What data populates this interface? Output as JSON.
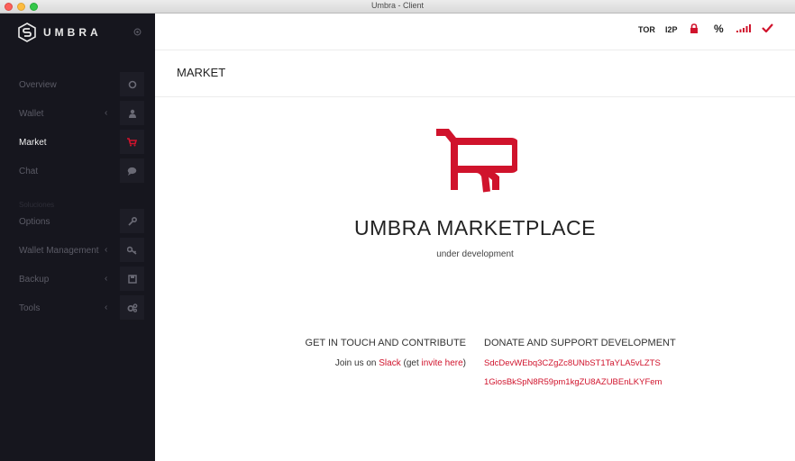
{
  "window": {
    "title": "Umbra - Client"
  },
  "logo": {
    "text": "UMBRA"
  },
  "sidebar": {
    "items": [
      {
        "label": "Overview",
        "icon": "circle-icon",
        "chevron": false,
        "active": false
      },
      {
        "label": "Wallet",
        "icon": "user-icon",
        "chevron": true,
        "active": false
      },
      {
        "label": "Market",
        "icon": "cart-icon",
        "chevron": false,
        "active": true
      },
      {
        "label": "Chat",
        "icon": "chat-icon",
        "chevron": false,
        "active": false
      },
      {
        "label": "Options",
        "icon": "wrench-icon",
        "chevron": false,
        "active": false
      },
      {
        "label": "Wallet Management",
        "icon": "key-icon",
        "chevron": true,
        "active": false
      },
      {
        "label": "Backup",
        "icon": "save-icon",
        "chevron": true,
        "active": false
      },
      {
        "label": "Tools",
        "icon": "cogs-icon",
        "chevron": true,
        "active": false
      }
    ],
    "section_label": "Soluciones"
  },
  "topbar": {
    "tor": "TOR",
    "i2p": "I2P",
    "percent": "%"
  },
  "page": {
    "title": "MARKET"
  },
  "market": {
    "title": "UMBRA MARKETPLACE",
    "subtitle": "under development"
  },
  "contact": {
    "heading": "GET IN TOUCH AND CONTRIBUTE",
    "prefix": "Join us on ",
    "slack": "Slack",
    "mid": " (get ",
    "invite": "invite here",
    "suffix": ")"
  },
  "donate": {
    "heading": "DONATE AND SUPPORT DEVELOPMENT",
    "addresses": [
      "SdcDevWEbq3CZgZc8UNbST1TaYLA5vLZTS",
      "1GiosBkSpN8R59pm1kgZU8AZUBEnLKYFem"
    ]
  },
  "colors": {
    "accent": "#d0132c",
    "sidebar_bg": "#16161e"
  }
}
